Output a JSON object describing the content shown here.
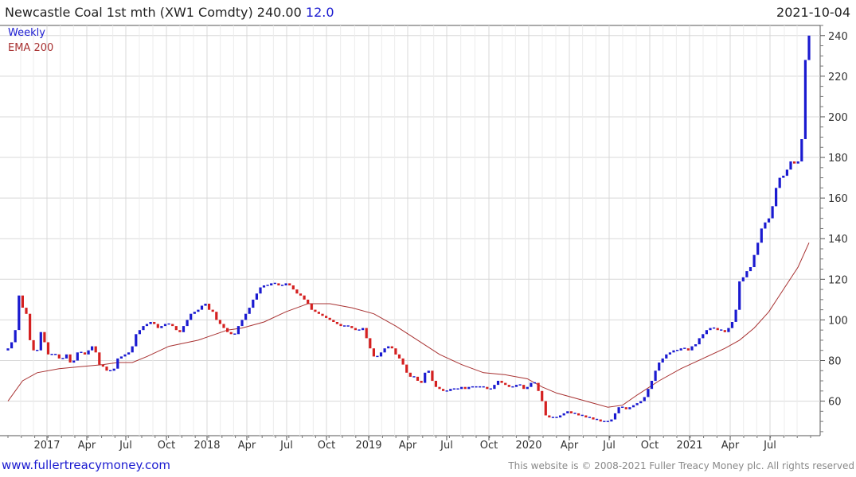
{
  "header": {
    "title": "Newcastle Coal 1st mth (XW1 Comdty) 240.00",
    "change": "12.0",
    "date": "2021-10-04"
  },
  "legend": {
    "series1": "Weekly",
    "series2": "EMA 200"
  },
  "footer": {
    "left": "www.fullertreacymoney.com",
    "right": "This website is © 2008-2021 Fuller Treacy Money plc. All rights reserved"
  },
  "colors": {
    "up": "#1a1ad0",
    "down": "#d42020",
    "ema": "#a83232",
    "grid": "#d8d8d8",
    "change": "#1a1ad0"
  },
  "chart_data": {
    "type": "candlestick-bar",
    "title": "Newcastle Coal 1st mth (XW1 Comdty) 240.00",
    "x_start": "2016-09",
    "x_end": "2021-10-04",
    "x_ticks": [
      "2017",
      "Apr",
      "Jul",
      "Oct",
      "2018",
      "Apr",
      "Jul",
      "Oct",
      "2019",
      "Apr",
      "Jul",
      "Oct",
      "2020",
      "Apr",
      "Jul",
      "Oct",
      "2021",
      "Apr",
      "Jul"
    ],
    "y_ticks": [
      60,
      80,
      100,
      120,
      140,
      160,
      180,
      200,
      220,
      240
    ],
    "ylim": [
      43,
      245
    ],
    "grid": true,
    "legend_position": "top-left",
    "series": [
      {
        "name": "Weekly",
        "kind": "weekly closes",
        "values": [
          86,
          89,
          95,
          112,
          106,
          103,
          90,
          85,
          85,
          94,
          89,
          83,
          83,
          83,
          81,
          81,
          83,
          79,
          80,
          84,
          84,
          83,
          85,
          87,
          84,
          78,
          77,
          75,
          75,
          76,
          81,
          82,
          83,
          84,
          87,
          93,
          95,
          97,
          98,
          99,
          98,
          96,
          97,
          98,
          98,
          97,
          95,
          94,
          97,
          100,
          103,
          104,
          105,
          107,
          108,
          105,
          104,
          100,
          98,
          96,
          94,
          93,
          93,
          97,
          100,
          103,
          106,
          110,
          113,
          116,
          117,
          117,
          118,
          118,
          117,
          117,
          118,
          117,
          115,
          113,
          112,
          110,
          108,
          105,
          104,
          103,
          102,
          101,
          100,
          99,
          98,
          97,
          97,
          97,
          96,
          95,
          95,
          96,
          91,
          86,
          82,
          82,
          84,
          86,
          87,
          86,
          83,
          81,
          78,
          74,
          72,
          72,
          70,
          69,
          74,
          75,
          70,
          67,
          66,
          65,
          65,
          66,
          66,
          66,
          67,
          66,
          67,
          67,
          67,
          67,
          67,
          66,
          66,
          68,
          70,
          69,
          68,
          67,
          67,
          68,
          68,
          66,
          67,
          69,
          69,
          65,
          60,
          53,
          52,
          52,
          52,
          53,
          54,
          55,
          54,
          54,
          53,
          53,
          52,
          52,
          51,
          51,
          50,
          50,
          50,
          51,
          54,
          57,
          57,
          56,
          57,
          58,
          59,
          60,
          62,
          66,
          70,
          75,
          79,
          81,
          83,
          84,
          85,
          85,
          86,
          86,
          85,
          87,
          88,
          91,
          93,
          95,
          96,
          96,
          95,
          95,
          94,
          96,
          99,
          105,
          119,
          121,
          124,
          126,
          132,
          138,
          145,
          148,
          150,
          156,
          165,
          170,
          171,
          174,
          178,
          177,
          178,
          189,
          228,
          240
        ]
      },
      {
        "name": "EMA 200",
        "kind": "moving average",
        "points": [
          [
            0,
            60
          ],
          [
            4,
            70
          ],
          [
            8,
            74
          ],
          [
            14,
            76
          ],
          [
            20,
            77
          ],
          [
            26,
            78
          ],
          [
            30,
            79
          ],
          [
            34,
            79
          ],
          [
            38,
            82
          ],
          [
            44,
            87
          ],
          [
            52,
            90
          ],
          [
            60,
            95
          ],
          [
            64,
            96
          ],
          [
            70,
            99
          ],
          [
            76,
            104
          ],
          [
            82,
            108
          ],
          [
            88,
            108
          ],
          [
            94,
            106
          ],
          [
            100,
            103
          ],
          [
            106,
            97
          ],
          [
            112,
            90
          ],
          [
            118,
            83
          ],
          [
            124,
            78
          ],
          [
            130,
            74
          ],
          [
            136,
            73
          ],
          [
            142,
            71
          ],
          [
            146,
            67
          ],
          [
            150,
            64
          ],
          [
            156,
            61
          ],
          [
            160,
            59
          ],
          [
            164,
            57
          ],
          [
            168,
            58
          ],
          [
            172,
            63
          ],
          [
            178,
            70
          ],
          [
            184,
            76
          ],
          [
            190,
            81
          ],
          [
            196,
            86
          ],
          [
            200,
            90
          ],
          [
            204,
            96
          ],
          [
            208,
            104
          ],
          [
            212,
            115
          ],
          [
            216,
            126
          ],
          [
            219,
            138
          ]
        ]
      }
    ]
  }
}
